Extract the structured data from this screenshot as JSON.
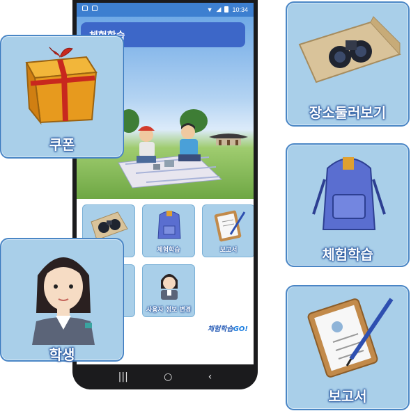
{
  "status_bar": {
    "time": "10:34"
  },
  "app": {
    "title": "체험학습"
  },
  "menu": {
    "tiles": [
      {
        "label": ""
      },
      {
        "label": "체험학습"
      },
      {
        "label": "보고서"
      },
      {
        "label": ""
      },
      {
        "label": "사용자 정보 변경"
      }
    ],
    "brand": "체험학습",
    "brand_go": "GO!"
  },
  "cards": {
    "coupon": "쿠폰",
    "student": "학생",
    "place_browse": "장소둘러보기",
    "experience": "체험학습",
    "report": "보고서"
  },
  "navbar": {
    "recent": "|||",
    "home": "○",
    "back": "‹"
  },
  "colors": {
    "card_bg": "#a9cfe9",
    "card_border": "#4a86c5",
    "appbar": "#3d67c8",
    "statusbar": "#3d7fd0"
  }
}
